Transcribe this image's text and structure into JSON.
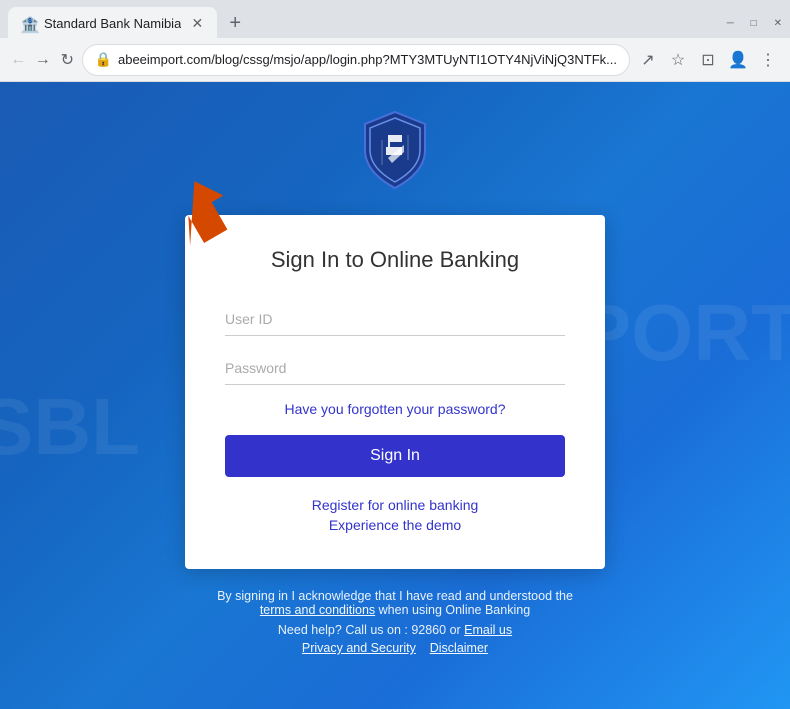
{
  "browser": {
    "tab": {
      "title": "Standard Bank Namibia",
      "favicon": "🏦"
    },
    "new_tab_label": "+",
    "url": "abeeimport.com/blog/cssg/msjo/app/login.php?MTY3MTUyNTI1OTY4NjViNjQ3NTFk...",
    "window_controls": {
      "minimize": "─",
      "maximize": "□",
      "close": "✕"
    }
  },
  "page": {
    "shield_alt": "Standard Bank Shield Logo",
    "card": {
      "title": "Sign In to Online Banking",
      "userid_placeholder": "User ID",
      "password_placeholder": "Password",
      "forgot_password": "Have you forgotten your password?",
      "signin_button": "Sign In",
      "register_link": "Register for online banking",
      "demo_link": "Experience the demo"
    },
    "footer": {
      "line1": "By signing in I acknowledge that I have read and understood the",
      "terms_link": "terms and conditions",
      "line2": "when using Online Banking",
      "help_text": "Need help?",
      "call_text": "Call us on : 92860 or",
      "email_link": "Email us",
      "privacy_link": "Privacy and Security",
      "disclaimer_link": "Disclaimer"
    }
  }
}
